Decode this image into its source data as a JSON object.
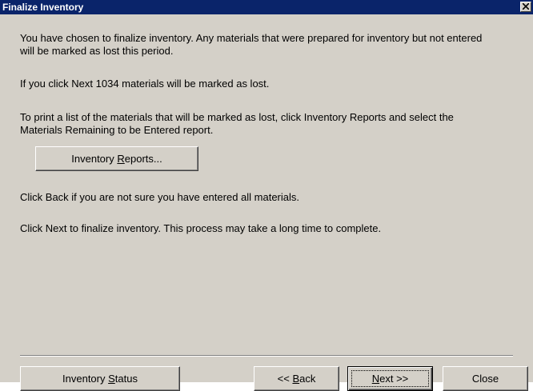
{
  "window": {
    "title": "Finalize Inventory"
  },
  "body": {
    "para1": "You have chosen to finalize inventory.  Any materials that were prepared for inventory but not entered\nwill be marked as lost this period.",
    "para2": "If you click Next 1034 materials will be marked as lost.",
    "para3": "To print a list of the materials that will be marked as lost, click Inventory Reports and select the\nMaterials Remaining to be Entered report.",
    "para4": "Click Back if you are not sure you have entered all materials.",
    "para5": "Click Next to finalize inventory. This process may take a long time to complete."
  },
  "buttons": {
    "inventory_reports": {
      "pre": "Inventory ",
      "mnemonic": "R",
      "post": "eports..."
    },
    "inventory_status": {
      "pre": "Inventory ",
      "mnemonic": "S",
      "post": "tatus"
    },
    "back": {
      "pre": "<< ",
      "mnemonic": "B",
      "post": "ack"
    },
    "next": {
      "pre": "",
      "mnemonic": "N",
      "post": "ext >>"
    },
    "close": {
      "label": "Close"
    }
  },
  "colors": {
    "titlebar": "#0a246a",
    "face": "#d4d0c8"
  },
  "icons": {
    "close": "close-icon"
  }
}
